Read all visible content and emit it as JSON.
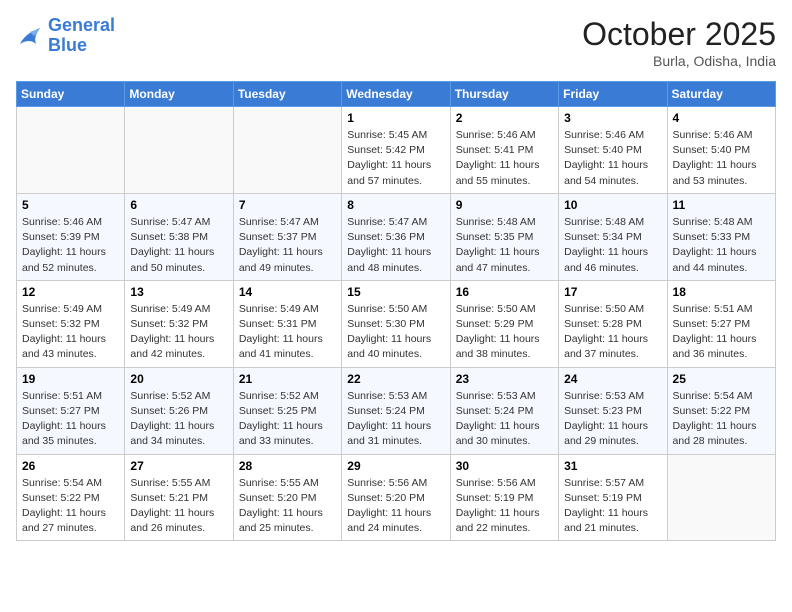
{
  "logo": {
    "line1": "General",
    "line2": "Blue"
  },
  "title": "October 2025",
  "subtitle": "Burla, Odisha, India",
  "days_header": [
    "Sunday",
    "Monday",
    "Tuesday",
    "Wednesday",
    "Thursday",
    "Friday",
    "Saturday"
  ],
  "weeks": [
    [
      {
        "day": "",
        "info": ""
      },
      {
        "day": "",
        "info": ""
      },
      {
        "day": "",
        "info": ""
      },
      {
        "day": "1",
        "info": "Sunrise: 5:45 AM\nSunset: 5:42 PM\nDaylight: 11 hours and 57 minutes."
      },
      {
        "day": "2",
        "info": "Sunrise: 5:46 AM\nSunset: 5:41 PM\nDaylight: 11 hours and 55 minutes."
      },
      {
        "day": "3",
        "info": "Sunrise: 5:46 AM\nSunset: 5:40 PM\nDaylight: 11 hours and 54 minutes."
      },
      {
        "day": "4",
        "info": "Sunrise: 5:46 AM\nSunset: 5:40 PM\nDaylight: 11 hours and 53 minutes."
      }
    ],
    [
      {
        "day": "5",
        "info": "Sunrise: 5:46 AM\nSunset: 5:39 PM\nDaylight: 11 hours and 52 minutes."
      },
      {
        "day": "6",
        "info": "Sunrise: 5:47 AM\nSunset: 5:38 PM\nDaylight: 11 hours and 50 minutes."
      },
      {
        "day": "7",
        "info": "Sunrise: 5:47 AM\nSunset: 5:37 PM\nDaylight: 11 hours and 49 minutes."
      },
      {
        "day": "8",
        "info": "Sunrise: 5:47 AM\nSunset: 5:36 PM\nDaylight: 11 hours and 48 minutes."
      },
      {
        "day": "9",
        "info": "Sunrise: 5:48 AM\nSunset: 5:35 PM\nDaylight: 11 hours and 47 minutes."
      },
      {
        "day": "10",
        "info": "Sunrise: 5:48 AM\nSunset: 5:34 PM\nDaylight: 11 hours and 46 minutes."
      },
      {
        "day": "11",
        "info": "Sunrise: 5:48 AM\nSunset: 5:33 PM\nDaylight: 11 hours and 44 minutes."
      }
    ],
    [
      {
        "day": "12",
        "info": "Sunrise: 5:49 AM\nSunset: 5:32 PM\nDaylight: 11 hours and 43 minutes."
      },
      {
        "day": "13",
        "info": "Sunrise: 5:49 AM\nSunset: 5:32 PM\nDaylight: 11 hours and 42 minutes."
      },
      {
        "day": "14",
        "info": "Sunrise: 5:49 AM\nSunset: 5:31 PM\nDaylight: 11 hours and 41 minutes."
      },
      {
        "day": "15",
        "info": "Sunrise: 5:50 AM\nSunset: 5:30 PM\nDaylight: 11 hours and 40 minutes."
      },
      {
        "day": "16",
        "info": "Sunrise: 5:50 AM\nSunset: 5:29 PM\nDaylight: 11 hours and 38 minutes."
      },
      {
        "day": "17",
        "info": "Sunrise: 5:50 AM\nSunset: 5:28 PM\nDaylight: 11 hours and 37 minutes."
      },
      {
        "day": "18",
        "info": "Sunrise: 5:51 AM\nSunset: 5:27 PM\nDaylight: 11 hours and 36 minutes."
      }
    ],
    [
      {
        "day": "19",
        "info": "Sunrise: 5:51 AM\nSunset: 5:27 PM\nDaylight: 11 hours and 35 minutes."
      },
      {
        "day": "20",
        "info": "Sunrise: 5:52 AM\nSunset: 5:26 PM\nDaylight: 11 hours and 34 minutes."
      },
      {
        "day": "21",
        "info": "Sunrise: 5:52 AM\nSunset: 5:25 PM\nDaylight: 11 hours and 33 minutes."
      },
      {
        "day": "22",
        "info": "Sunrise: 5:53 AM\nSunset: 5:24 PM\nDaylight: 11 hours and 31 minutes."
      },
      {
        "day": "23",
        "info": "Sunrise: 5:53 AM\nSunset: 5:24 PM\nDaylight: 11 hours and 30 minutes."
      },
      {
        "day": "24",
        "info": "Sunrise: 5:53 AM\nSunset: 5:23 PM\nDaylight: 11 hours and 29 minutes."
      },
      {
        "day": "25",
        "info": "Sunrise: 5:54 AM\nSunset: 5:22 PM\nDaylight: 11 hours and 28 minutes."
      }
    ],
    [
      {
        "day": "26",
        "info": "Sunrise: 5:54 AM\nSunset: 5:22 PM\nDaylight: 11 hours and 27 minutes."
      },
      {
        "day": "27",
        "info": "Sunrise: 5:55 AM\nSunset: 5:21 PM\nDaylight: 11 hours and 26 minutes."
      },
      {
        "day": "28",
        "info": "Sunrise: 5:55 AM\nSunset: 5:20 PM\nDaylight: 11 hours and 25 minutes."
      },
      {
        "day": "29",
        "info": "Sunrise: 5:56 AM\nSunset: 5:20 PM\nDaylight: 11 hours and 24 minutes."
      },
      {
        "day": "30",
        "info": "Sunrise: 5:56 AM\nSunset: 5:19 PM\nDaylight: 11 hours and 22 minutes."
      },
      {
        "day": "31",
        "info": "Sunrise: 5:57 AM\nSunset: 5:19 PM\nDaylight: 11 hours and 21 minutes."
      },
      {
        "day": "",
        "info": ""
      }
    ]
  ]
}
